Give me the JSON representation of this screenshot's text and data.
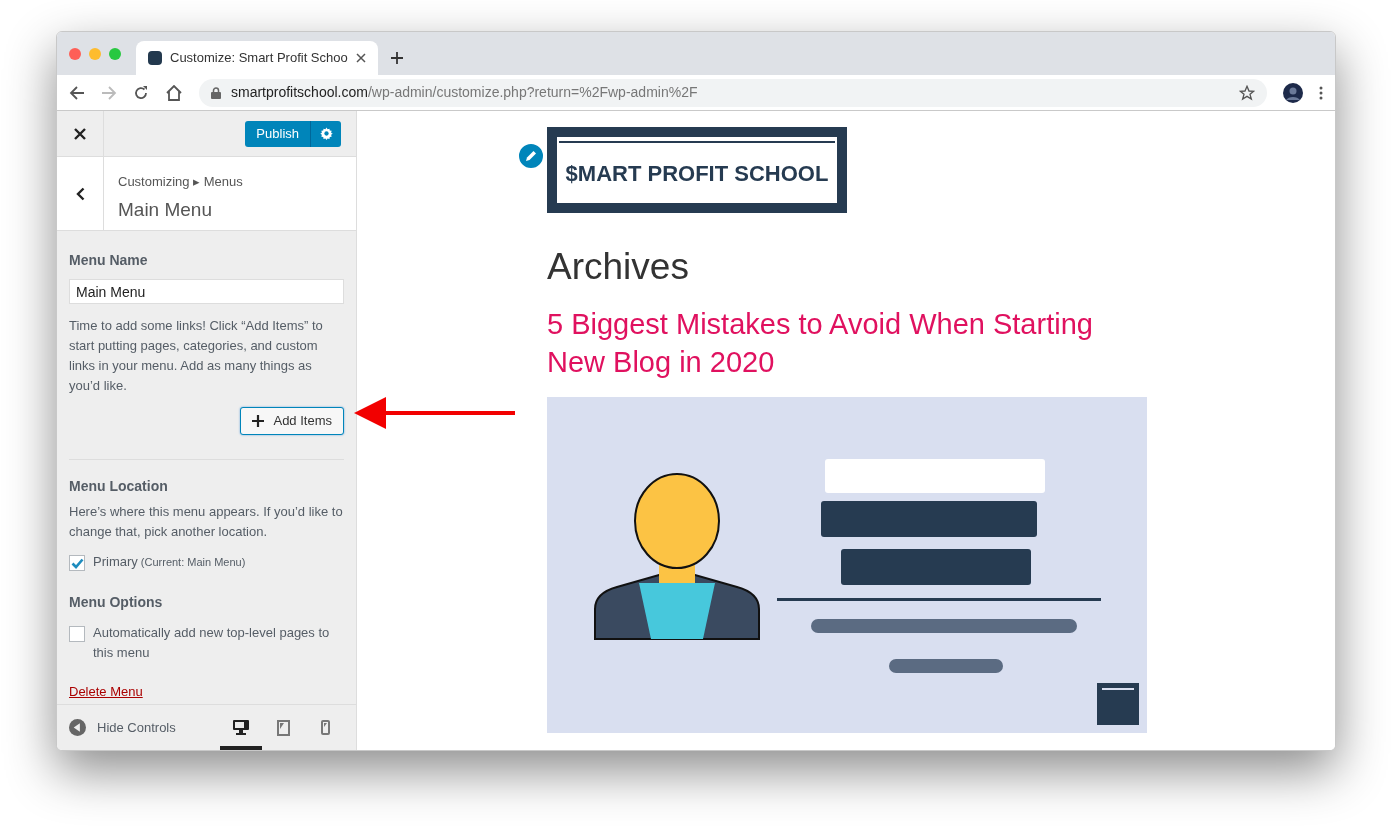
{
  "browser": {
    "tab": {
      "title": "Customize: Smart Profit Schoo",
      "selected": true
    },
    "url": {
      "domain": "smartprofitschool.com",
      "path": "/wp-admin/customize.php?return=%2Fwp-admin%2F"
    }
  },
  "sidebar": {
    "publish_button": "Publish",
    "breadcrumb": "Customizing ▸ Menus",
    "title": "Main Menu",
    "menu_name": {
      "label": "Menu Name",
      "value": "Main Menu"
    },
    "help": "Time to add some links! Click “Add Items” to start putting pages, categories, and custom links in your menu. Add as many things as you’d like.",
    "add_items_button": "Add Items",
    "menu_location": {
      "heading": "Menu Location",
      "description": "Here’s where this menu appears. If you’d like to change that, pick another location.",
      "locations": [
        {
          "label": "Primary",
          "note": "(Current: Main Menu)",
          "checked": true
        }
      ]
    },
    "menu_options": {
      "heading": "Menu Options",
      "options": [
        {
          "label": "Automatically add new top-level pages to this menu",
          "checked": false
        }
      ]
    },
    "delete_link": "Delete Menu",
    "footer": {
      "hide_controls": "Hide Controls",
      "devices": [
        {
          "kind": "desktop",
          "selected": true
        },
        {
          "kind": "tablet",
          "selected": false
        },
        {
          "kind": "mobile",
          "selected": false
        }
      ]
    }
  },
  "preview": {
    "logo_text": "$MART PROFIT SCHOOL",
    "heading": "Archives",
    "post_title": "5 Biggest Mistakes to Avoid When Starting New Blog in 2020"
  }
}
